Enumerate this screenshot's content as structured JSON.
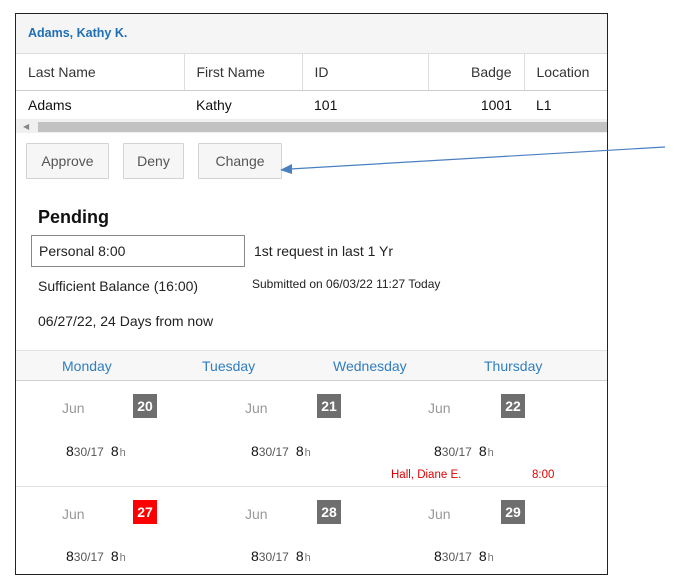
{
  "header": {
    "employee_name": "Adams, Kathy K."
  },
  "grid": {
    "columns": [
      "Last Name",
      "First Name",
      "ID",
      "Badge",
      "Location"
    ],
    "row": {
      "last_name": "Adams",
      "first_name": "Kathy",
      "id": "101",
      "badge": "1001",
      "location": "L1"
    }
  },
  "actions": {
    "approve": "Approve",
    "deny": "Deny",
    "change": "Change"
  },
  "request": {
    "status_title": "Pending",
    "type_value": "Personal 8:00",
    "count_info": "1st request in last 1 Yr",
    "balance": "Sufficient Balance (16:00)",
    "submitted": "Submitted on 06/03/22 11:27 Today",
    "days_from_now": "06/27/22, 24 Days from now"
  },
  "calendar": {
    "day_names": [
      "Monday",
      "Tuesday",
      "Wednesday",
      "Thursday"
    ],
    "weeks": [
      {
        "days": [
          {
            "month": "Jun",
            "date": "20",
            "start": "8",
            "start_min": "30",
            "end": "/17",
            "hours": "8",
            "hours_unit": "h"
          },
          {
            "month": "Jun",
            "date": "21",
            "start": "8",
            "start_min": "30",
            "end": "/17",
            "hours": "8",
            "hours_unit": "h"
          },
          {
            "month": "Jun",
            "date": "22",
            "start": "8",
            "start_min": "30",
            "end": "/17",
            "hours": "8",
            "hours_unit": "h"
          }
        ],
        "absence": {
          "name": "Hall, Diane E.",
          "time": "8:00"
        }
      },
      {
        "days": [
          {
            "month": "Jun",
            "date": "27",
            "start": "8",
            "start_min": "30",
            "end": "/17",
            "hours": "8",
            "hours_unit": "h"
          },
          {
            "month": "Jun",
            "date": "28",
            "start": "8",
            "start_min": "30",
            "end": "/17",
            "hours": "8",
            "hours_unit": "h"
          },
          {
            "month": "Jun",
            "date": "29",
            "start": "8",
            "start_min": "30",
            "end": "/17",
            "hours": "8",
            "hours_unit": "h"
          }
        ]
      }
    ]
  },
  "colors": {
    "accent": "#1f6fb4",
    "today": "#ff0000",
    "date_badge": "#6e6e6e",
    "absence": "#e00000",
    "annotation_arrow": "#4a7fc0"
  }
}
